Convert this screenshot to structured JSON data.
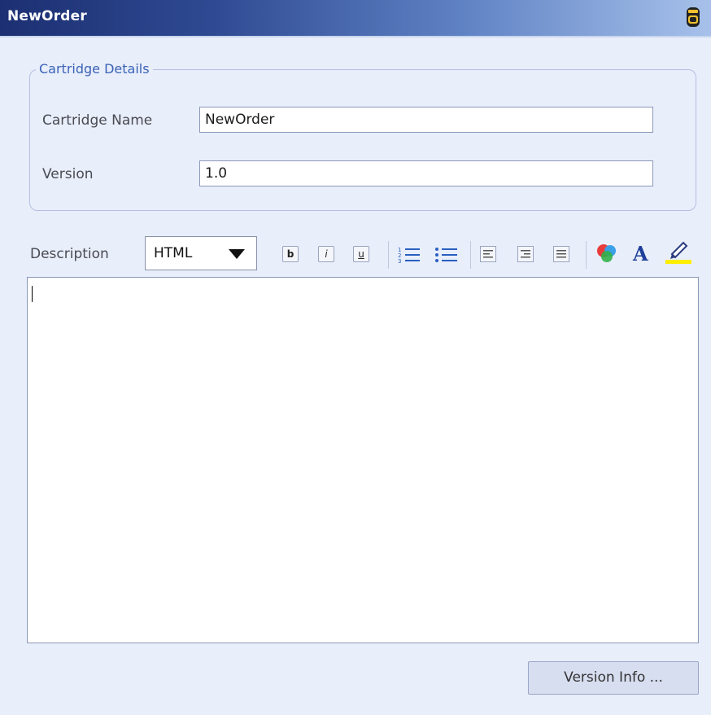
{
  "window": {
    "title": "NewOrder",
    "icon": "cartridge-icon"
  },
  "details": {
    "legend": "Cartridge Details",
    "name_label": "Cartridge Name",
    "name_value": "NewOrder",
    "version_label": "Version",
    "version_value": "1.0"
  },
  "description": {
    "label": "Description",
    "format_selected": "HTML",
    "toolbar": {
      "bold": "b",
      "italic": "i",
      "underline": "u",
      "icons": [
        "bold-icon",
        "italic-icon",
        "underline-icon",
        "ordered-list-icon",
        "unordered-list-icon",
        "align-left-icon",
        "align-center-icon",
        "align-right-icon",
        "color-palette-icon",
        "font-color-icon",
        "highlight-icon"
      ]
    },
    "content": ""
  },
  "footer": {
    "version_info_label": "Version Info ..."
  },
  "colors": {
    "title_dark": "#1c2f72",
    "title_light": "#a7c1ea",
    "panel_bg": "#e8eefa",
    "legend_text": "#3a62b6"
  }
}
